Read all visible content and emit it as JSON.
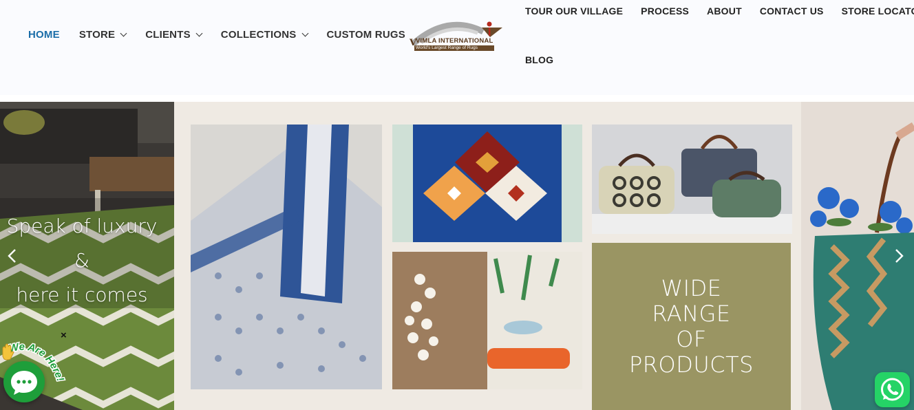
{
  "nav_left": {
    "home": "HOME",
    "store": "STORE",
    "clients": "CLIENTS",
    "collections": "COLLECTIONS",
    "custom_rugs": "CUSTOM RUGS"
  },
  "logo": {
    "brand": "VIMLA INTERNATIONAL",
    "tagline": "World's Largest Range of Rugs"
  },
  "nav_right": {
    "tour": "TOUR OUR VILLAGE",
    "process": "PROCESS",
    "about": "ABOUT",
    "contact": "CONTACT US",
    "store_locator": "STORE LOCATOR",
    "blog": "BLOG"
  },
  "slider": {
    "tagline_line1": "Speak of luxury",
    "tagline_line2": "&",
    "tagline_line3": "here it comes",
    "wide_line1": "WIDE",
    "wide_line2": "RANGE",
    "wide_line3": "OF",
    "wide_line4": "PRODUCTS"
  },
  "chat": {
    "label": "We Are Here!",
    "close": "×"
  },
  "colors": {
    "active_nav": "#1a6da8",
    "chat_green": "#1e9e3a",
    "whatsapp_green": "#25d366",
    "olive_tile": "#9a9563"
  }
}
